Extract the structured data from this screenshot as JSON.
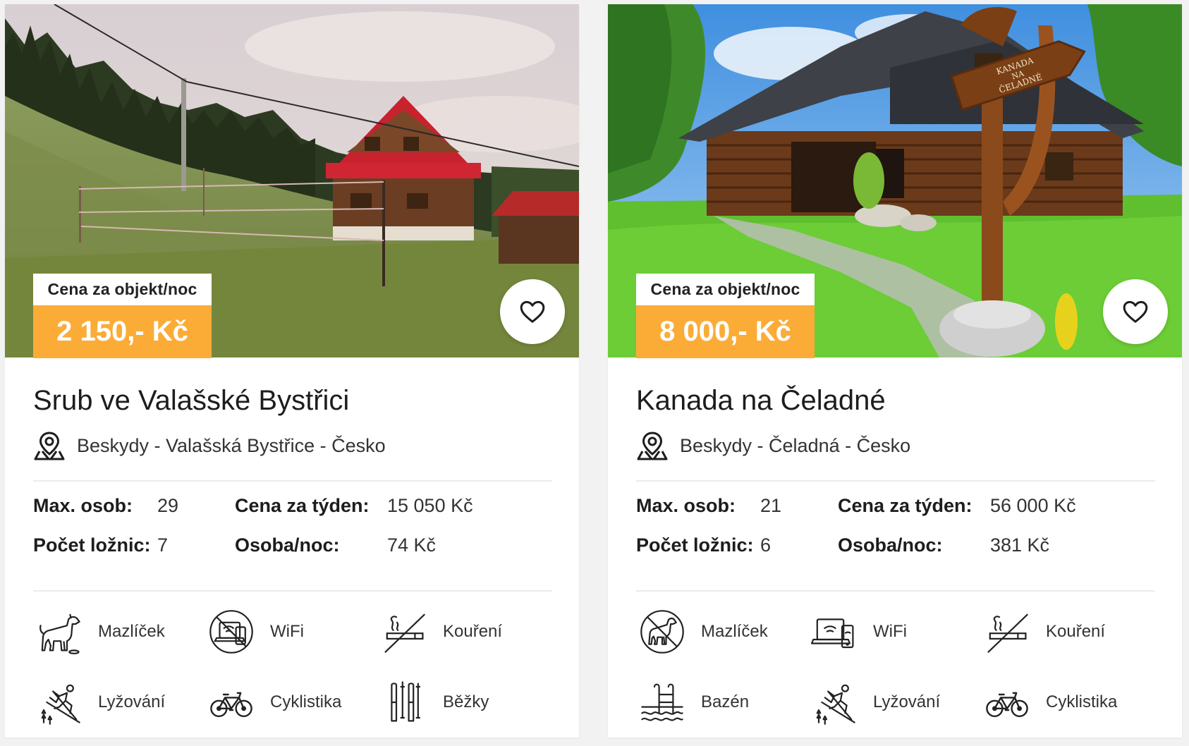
{
  "listings": [
    {
      "price_caption": "Cena za objekt/noc",
      "price": "2 150,- Kč",
      "title": "Srub ve Valašské Bystřici",
      "location": "Beskydy - Valašská Bystřice - Česko",
      "specs": {
        "max_persons_label": "Max. osob:",
        "max_persons": "29",
        "bedrooms_label": "Počet ložnic:",
        "bedrooms": "7",
        "week_price_label": "Cena za týden:",
        "week_price": "15 050 Kč",
        "person_night_label": "Osoba/noc:",
        "person_night": "74 Kč"
      },
      "amenities": [
        {
          "label": "Mazlíček",
          "icon": "dog-icon"
        },
        {
          "label": "WiFi",
          "icon": "no-wifi-icon"
        },
        {
          "label": "Kouření",
          "icon": "no-smoking-icon"
        },
        {
          "label": "Lyžování",
          "icon": "skiing-icon"
        },
        {
          "label": "Cyklistika",
          "icon": "bicycle-icon"
        },
        {
          "label": "Běžky",
          "icon": "cross-country-skis-icon"
        }
      ]
    },
    {
      "price_caption": "Cena za objekt/noc",
      "price": "8 000,- Kč",
      "title": "Kanada na Čeladné",
      "location": "Beskydy - Čeladná - Česko",
      "photo_sign": [
        "KANADA",
        "NA",
        "ČELADNÉ"
      ],
      "specs": {
        "max_persons_label": "Max. osob:",
        "max_persons": "21",
        "bedrooms_label": "Počet ložnic:",
        "bedrooms": "6",
        "week_price_label": "Cena za týden:",
        "week_price": "56 000 Kč",
        "person_night_label": "Osoba/noc:",
        "person_night": "381 Kč"
      },
      "amenities": [
        {
          "label": "Mazlíček",
          "icon": "no-pets-icon"
        },
        {
          "label": "WiFi",
          "icon": "wifi-devices-icon"
        },
        {
          "label": "Kouření",
          "icon": "no-smoking-icon"
        },
        {
          "label": "Bazén",
          "icon": "pool-icon"
        },
        {
          "label": "Lyžování",
          "icon": "skiing-icon"
        },
        {
          "label": "Cyklistika",
          "icon": "bicycle-icon"
        }
      ]
    }
  ],
  "colors": {
    "price_accent": "#fbac37",
    "card_bg": "#ffffff",
    "page_bg": "#f2f2f2"
  }
}
